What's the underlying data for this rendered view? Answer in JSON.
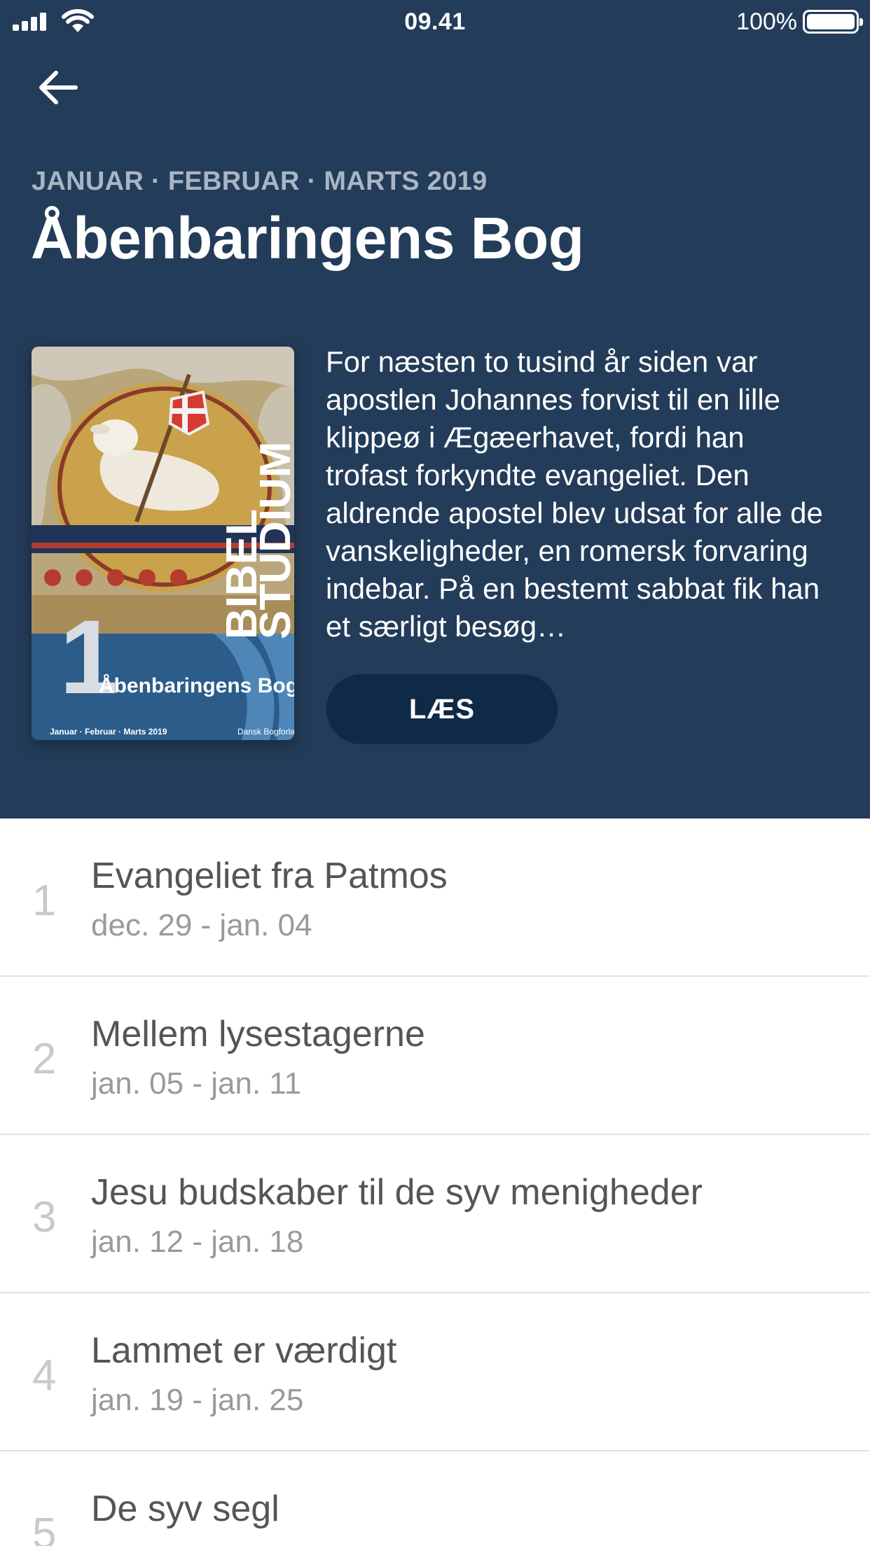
{
  "status_bar": {
    "time": "09.41",
    "battery_percent": "100%",
    "battery_level": 1.0
  },
  "header": {
    "quarter_label": "JANUAR · FEBRUAR · MARTS 2019",
    "title": "Åbenbaringens Bog",
    "background_color": "#233c59"
  },
  "cover": {
    "series_line1": "BIBEL",
    "series_line2": "STUDIUM",
    "number": "1",
    "title": "Åbenbaringens Bog",
    "quarter": "Januar · Februar · Marts 2019",
    "publisher": "Dansk Bogforlag"
  },
  "description": "For næsten to tusind år siden var apostlen Johannes forvist til en lille klippeø i Ægæerhavet, fordi han trofast forkyndte evangeliet. Den aldrende apostel blev udsat for alle de vanskeligheder, en romersk forvaring indebar. På en bestemt sabbat fik han et særligt besøg…",
  "read_button": {
    "label": "LÆS",
    "color": "#0f2a46"
  },
  "lessons": [
    {
      "number": "1",
      "title": "Evangeliet fra Patmos",
      "dates": "dec. 29 - jan. 04"
    },
    {
      "number": "2",
      "title": "Mellem lysestagerne",
      "dates": "jan. 05 - jan. 11"
    },
    {
      "number": "3",
      "title": "Jesu budskaber til de syv menigheder",
      "dates": "jan. 12 - jan. 18"
    },
    {
      "number": "4",
      "title": "Lammet er værdigt",
      "dates": "jan. 19 - jan. 25"
    },
    {
      "number": "5",
      "title": "De syv segl",
      "dates": ""
    }
  ]
}
